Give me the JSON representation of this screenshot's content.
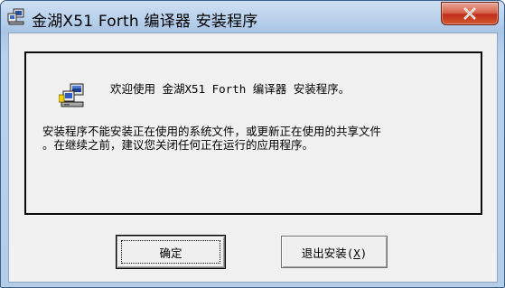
{
  "window": {
    "title": "金湖X51 Forth 编译器 安装程序",
    "title_icon": "setup-app-icon",
    "close_icon": "close-x-icon"
  },
  "message": {
    "icon": "setup-computer-icon",
    "welcome": "欢迎使用 金湖X51 Forth 编译器 安装程序。",
    "warning_line1": "安装程序不能安装正在使用的系统文件，或更新正在使用的共享文件",
    "warning_line2": "。在继续之前，建议您关闭任何正在运行的应用程序。"
  },
  "buttons": {
    "ok_label": "确定",
    "exit_label_prefix": "退出安装(",
    "exit_label_hotkey": "X",
    "exit_label_suffix": ")"
  },
  "colors": {
    "title_bar": "#b8d1ec",
    "close_button": "#c9432a",
    "dialog_background": "#f0f0f0"
  }
}
